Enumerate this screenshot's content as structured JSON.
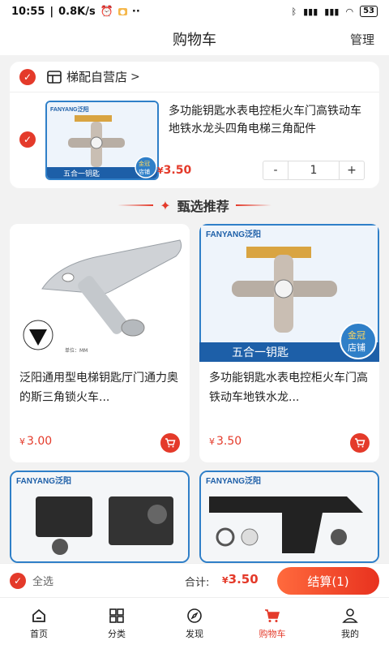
{
  "status_bar": {
    "time": "10:55",
    "speed": "0.8K/s",
    "battery": "53"
  },
  "nav": {
    "title": "购物车",
    "manage": "管理"
  },
  "cart": {
    "store_name": "梯配自营店",
    "store_arrow": ">",
    "item": {
      "title": "多功能钥匙水表电控柜火车门高铁动车地铁水龙头四角电梯三角配件",
      "currency": "¥",
      "price": "3.50",
      "quantity": "1",
      "minus": "-",
      "plus": "+",
      "thumb_brand": "FANYANG泛阳",
      "thumb_caption": "五合一钥匙",
      "thumb_badge_1": "金冠",
      "thumb_badge_2": "店铺"
    }
  },
  "recommend": {
    "title": "甄选推荐",
    "products": [
      {
        "name": "泛阳通用型电梯钥匙厅门通力奥的斯三角锁火车...",
        "currency": "¥",
        "price": "3.00",
        "unit_note": "单位：MM"
      },
      {
        "name": "多功能钥匙水表电控柜火车门高铁动车地铁水龙...",
        "currency": "¥",
        "price": "3.50",
        "brand": "FANYANG泛阳",
        "caption": "五合一钥匙",
        "badge_1": "金冠",
        "badge_2": "店铺"
      },
      {
        "brand": "FANYANG泛阳"
      },
      {
        "brand": "FANYANG泛阳"
      }
    ]
  },
  "checkout": {
    "select_all": "全选",
    "total_label": "合计:",
    "currency": "¥",
    "total": "3.50",
    "button": "结算(1)"
  },
  "tabs": [
    {
      "label": "首页",
      "icon": "home-icon"
    },
    {
      "label": "分类",
      "icon": "grid-icon"
    },
    {
      "label": "发现",
      "icon": "compass-icon"
    },
    {
      "label": "购物车",
      "icon": "cart-icon"
    },
    {
      "label": "我的",
      "icon": "user-icon"
    }
  ],
  "colors": {
    "accent": "#e43a2a",
    "thumb_blue": "#2f7fc8"
  }
}
